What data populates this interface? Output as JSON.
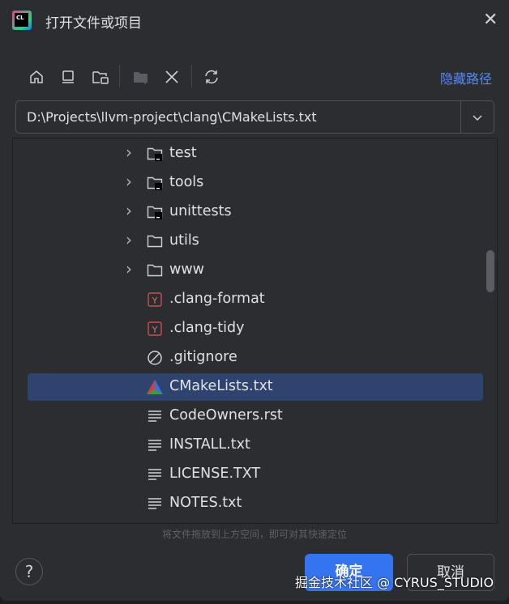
{
  "title": "打开文件或项目",
  "logo_text": "CL",
  "toolbar": {
    "icons": [
      "home-icon",
      "desktop-icon",
      "project-folder-icon",
      "new-folder-icon",
      "delete-icon",
      "refresh-icon"
    ],
    "hide_path": "隐藏路径"
  },
  "path": "D:\\Projects\\llvm-project\\clang\\CMakeLists.txt",
  "tree": [
    {
      "label": "test",
      "type": "module-folder",
      "expandable": true
    },
    {
      "label": "tools",
      "type": "module-folder",
      "expandable": true
    },
    {
      "label": "unittests",
      "type": "module-folder",
      "expandable": true
    },
    {
      "label": "utils",
      "type": "folder",
      "expandable": true
    },
    {
      "label": "www",
      "type": "folder",
      "expandable": true
    },
    {
      "label": ".clang-format",
      "type": "yaml"
    },
    {
      "label": ".clang-tidy",
      "type": "yaml"
    },
    {
      "label": ".gitignore",
      "type": "ignore"
    },
    {
      "label": "CMakeLists.txt",
      "type": "cmake",
      "selected": true
    },
    {
      "label": "CodeOwners.rst",
      "type": "text"
    },
    {
      "label": "INSTALL.txt",
      "type": "text"
    },
    {
      "label": "LICENSE.TXT",
      "type": "text"
    },
    {
      "label": "NOTES.txt",
      "type": "text"
    }
  ],
  "hint": "将文件拖放到上方空间，即可对其快速定位",
  "help": "?",
  "ok": "确定",
  "cancel": "取消",
  "watermark": "掘金技术社区 @ CYRUS_STUDIO",
  "colors": {
    "accent": "#3574f0",
    "selection": "#2e436e",
    "link": "#548af7"
  }
}
